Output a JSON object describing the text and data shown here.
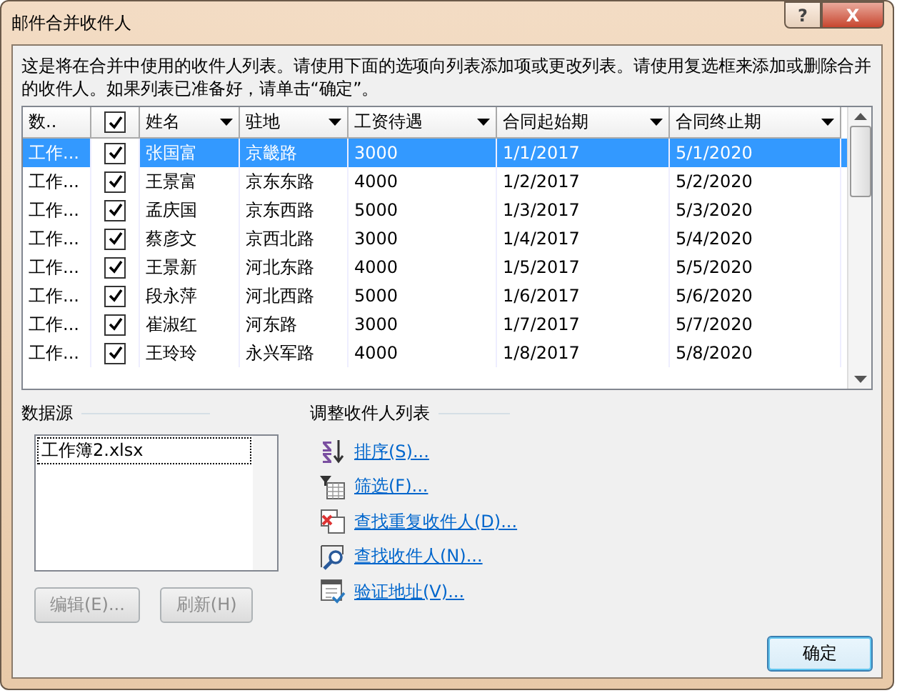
{
  "window": {
    "title": "邮件合并收件人",
    "help": "?",
    "close": "X"
  },
  "intro": "这是将在合并中使用的收件人列表。请使用下面的选项向列表添加项或更改列表。请使用复选框来添加或删除合并的收件人。如果列表已准备好，请单击“确定”。",
  "table": {
    "select_all": {
      "checked": true
    },
    "columns": [
      {
        "label": "数..",
        "kind": "plain"
      },
      {
        "label": "姓名",
        "kind": "sort"
      },
      {
        "label": "驻地",
        "kind": "sort"
      },
      {
        "label": "工资待遇",
        "kind": "sort"
      },
      {
        "label": "合同起始期",
        "kind": "sort"
      },
      {
        "label": "合同终止期",
        "kind": "sort"
      }
    ],
    "rows": [
      {
        "selected": true,
        "checked": true,
        "cells": [
          "工作...",
          "张国富",
          "京畿路",
          "3000",
          "1/1/2017",
          "5/1/2020"
        ]
      },
      {
        "selected": false,
        "checked": true,
        "cells": [
          "工作...",
          "王景富",
          "京东东路",
          "4000",
          "1/2/2017",
          "5/2/2020"
        ]
      },
      {
        "selected": false,
        "checked": true,
        "cells": [
          "工作...",
          "孟庆国",
          "京东西路",
          "5000",
          "1/3/2017",
          "5/3/2020"
        ]
      },
      {
        "selected": false,
        "checked": true,
        "cells": [
          "工作...",
          "蔡彦文",
          "京西北路",
          "3000",
          "1/4/2017",
          "5/4/2020"
        ]
      },
      {
        "selected": false,
        "checked": true,
        "cells": [
          "工作...",
          "王景新",
          "河北东路",
          "4000",
          "1/5/2017",
          "5/5/2020"
        ]
      },
      {
        "selected": false,
        "checked": true,
        "cells": [
          "工作...",
          "段永萍",
          "河北西路",
          "5000",
          "1/6/2017",
          "5/6/2020"
        ]
      },
      {
        "selected": false,
        "checked": true,
        "cells": [
          "工作...",
          "崔淑红",
          "河东路",
          "3000",
          "1/7/2017",
          "5/7/2020"
        ]
      },
      {
        "selected": false,
        "checked": true,
        "cells": [
          "工作...",
          "王玲玲",
          "永兴军路",
          "4000",
          "1/8/2017",
          "5/8/2020"
        ]
      }
    ]
  },
  "data_source": {
    "label": "数据源",
    "items": [
      {
        "label": "工作簿2.xlsx",
        "selected": true
      }
    ],
    "buttons": [
      {
        "label": "编辑(E)...",
        "disabled": true
      },
      {
        "label": "刷新(H)",
        "disabled": true
      }
    ]
  },
  "adjust": {
    "label": "调整收件人列表",
    "links": [
      {
        "label": "排序(S)...",
        "kind": "sort"
      },
      {
        "label": "筛选(F)...",
        "kind": "filter"
      },
      {
        "label": "查找重复收件人(D)...",
        "kind": "duplicate"
      },
      {
        "label": "查找收件人(N)...",
        "kind": "find"
      },
      {
        "label": "验证地址(V)...",
        "kind": "validate"
      }
    ]
  },
  "ok_button": "确定"
}
